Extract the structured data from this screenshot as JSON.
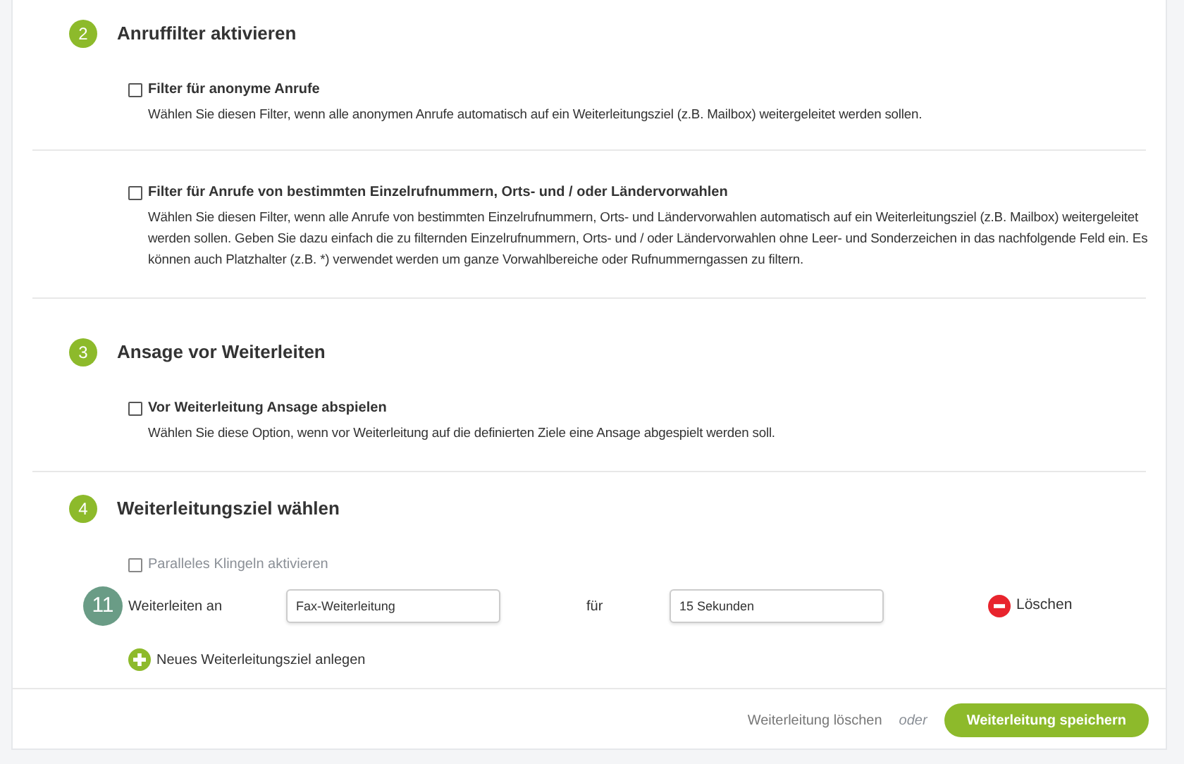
{
  "sections": [
    {
      "number": "2",
      "title": "Anruffilter aktivieren",
      "options": [
        {
          "label": "Filter für anonyme Anrufe",
          "checked": false,
          "description": "Wählen Sie diesen Filter, wenn alle anonymen Anrufe automatisch auf ein Weiterleitungsziel (z.B. Mailbox) weitergeleitet werden sollen."
        },
        {
          "label": "Filter für Anrufe von bestimmten Einzelrufnummern, Orts- und / oder Ländervorwahlen",
          "checked": false,
          "description": "Wählen Sie diesen Filter, wenn alle Anrufe von bestimmten Einzelrufnummern, Orts- und Ländervorwahlen automatisch auf ein Weiterleitungsziel (z.B. Mailbox) weitergeleitet werden sollen. Geben Sie dazu einfach die zu filternden Einzelrufnummern, Orts- und / oder Ländervorwahlen ohne Leer- und Sonderzeichen in das nachfolgende Feld ein. Es können auch Platzhalter (z.B. *) verwendet werden um ganze Vorwahlbereiche oder Rufnummerngassen zu filtern."
        }
      ]
    },
    {
      "number": "3",
      "title": "Ansage vor Weiterleiten",
      "options": [
        {
          "label": "Vor Weiterleitung Ansage abspielen",
          "checked": false,
          "description": "Wählen Sie diese Option, wenn vor Weiterleitung auf die definierten Ziele eine Ansage abgespielt werden soll."
        }
      ]
    },
    {
      "number": "4",
      "title": "Weiterleitungsziel wählen",
      "parallel": {
        "label": "Paralleles Klingeln aktivieren",
        "checked": false
      },
      "targets": [
        {
          "badge": "11",
          "label": "Weiterleiten an",
          "value": "Fax-Weiterleitung",
          "for_label": "für",
          "duration": "15 Sekunden",
          "delete": "Löschen"
        }
      ],
      "add": "Neues Weiterleitungsziel anlegen"
    }
  ],
  "footer": {
    "delete_link": "Weiterleitung löschen",
    "separator": "oder",
    "save_button": "Weiterleitung speichern"
  }
}
